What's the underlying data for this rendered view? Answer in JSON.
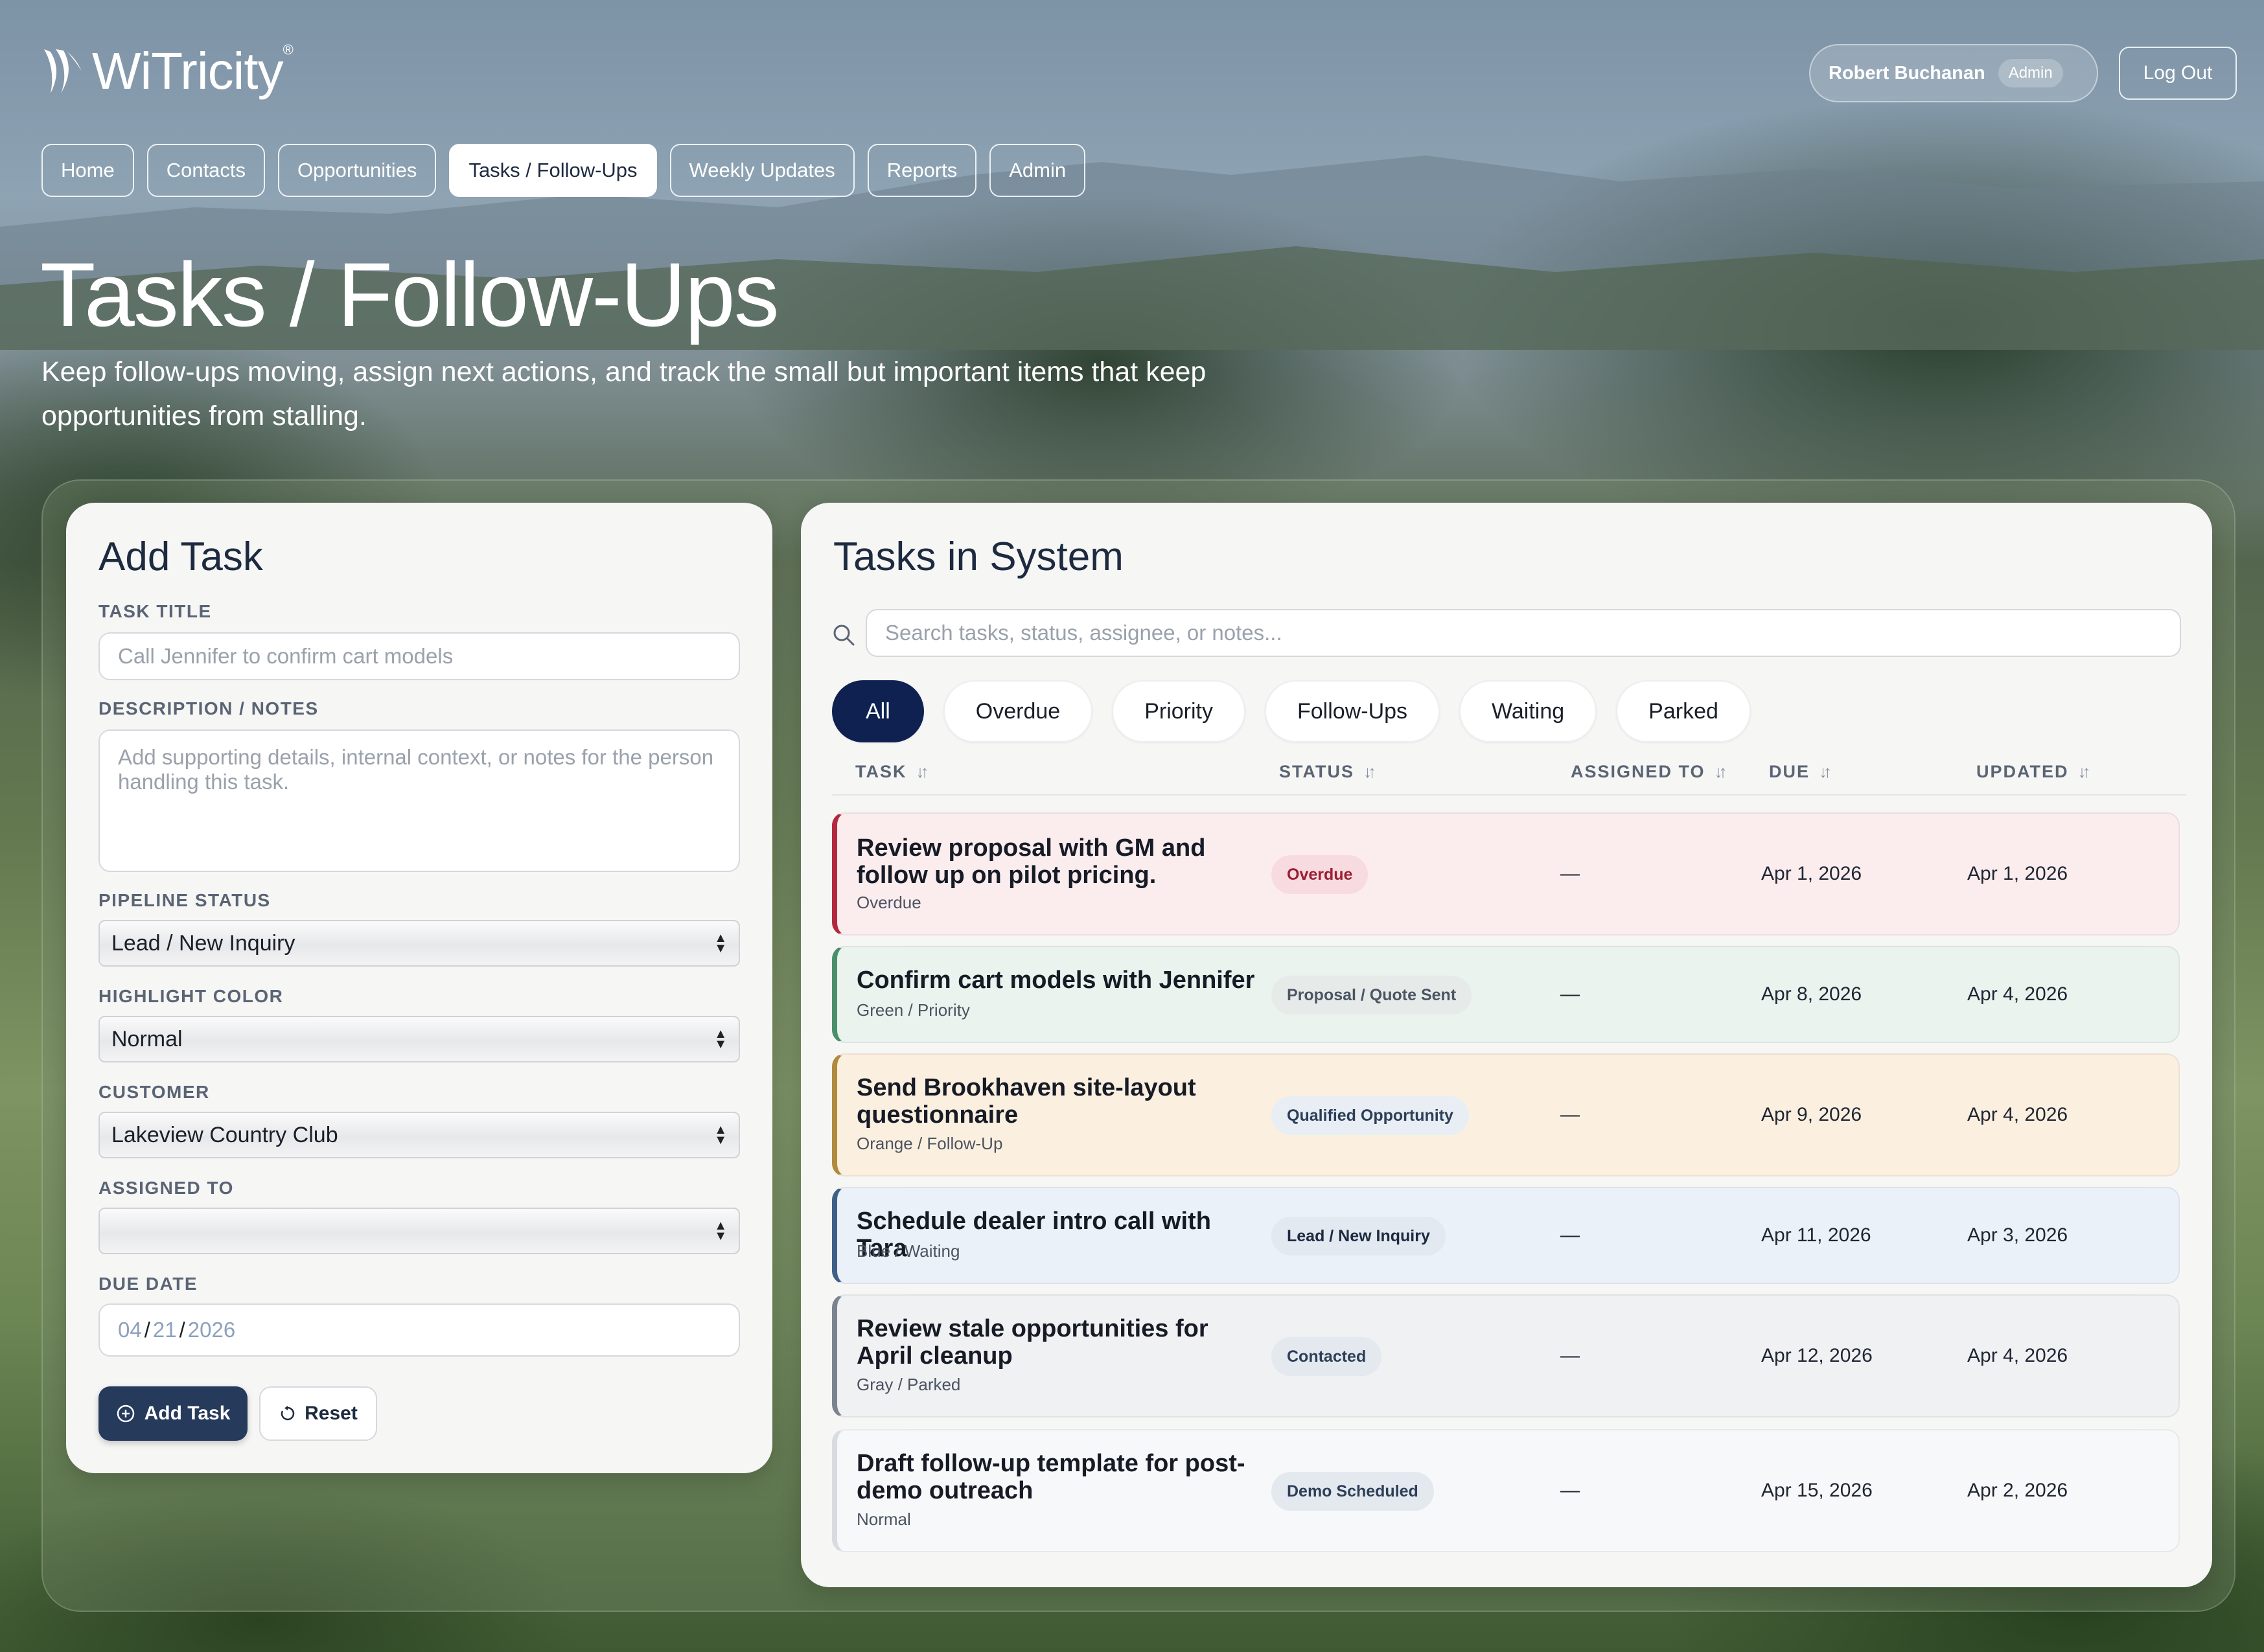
{
  "header": {
    "logo_text": "WiTricity",
    "logo_reg": "®",
    "user_name": "Robert Buchanan",
    "user_role": "Admin",
    "logout_label": "Log Out"
  },
  "nav": {
    "tabs": [
      {
        "label": "Home"
      },
      {
        "label": "Contacts"
      },
      {
        "label": "Opportunities"
      },
      {
        "label": "Tasks / Follow-Ups"
      },
      {
        "label": "Weekly Updates"
      },
      {
        "label": "Reports"
      },
      {
        "label": "Admin"
      }
    ],
    "active_tab": "Tasks / Follow-Ups"
  },
  "page": {
    "title": "Tasks / Follow-Ups",
    "subtitle": "Keep follow-ups moving, assign next actions, and track the small but important items that keep opportunities from stalling."
  },
  "add_task": {
    "title": "Add Task",
    "task_title_label": "TASK TITLE",
    "task_title_placeholder": "Call Jennifer to confirm cart models",
    "description_label": "DESCRIPTION / NOTES",
    "description_placeholder": "Add supporting details, internal context, or notes for the person handling this task.",
    "pipeline_label": "PIPELINE STATUS",
    "pipeline_value": "Lead / New Inquiry",
    "highlight_label": "HIGHLIGHT COLOR",
    "highlight_value": "Normal",
    "customer_label": "CUSTOMER",
    "customer_value": "Lakeview Country Club",
    "assigned_label": "ASSIGNED TO",
    "assigned_value": "",
    "due_label": "DUE DATE",
    "due_month": "04",
    "due_day": "21",
    "due_year": "2026",
    "add_button": "Add Task",
    "reset_button": "Reset"
  },
  "tasks_list": {
    "title": "Tasks in System",
    "search_placeholder": "Search tasks, status, assignee, or notes...",
    "filters": [
      "All",
      "Overdue",
      "Priority",
      "Follow-Ups",
      "Waiting",
      "Parked"
    ],
    "active_filter": "All",
    "columns": [
      "TASK",
      "STATUS",
      "ASSIGNED TO",
      "DUE",
      "UPDATED"
    ],
    "rows": [
      {
        "title": "Review proposal with GM and follow up on pilot pricing.",
        "sub": "Overdue",
        "status": "Overdue",
        "assigned": "—",
        "due": "Apr 1, 2026",
        "updated": "Apr 1, 2026",
        "bg": "#fbecee",
        "border": "#b2293f",
        "badge_bg": "#f8dbe0",
        "badge_fg": "#9a1f32"
      },
      {
        "title": "Confirm cart models with Jennifer",
        "sub": "Green / Priority",
        "status": "Proposal / Quote Sent",
        "assigned": "—",
        "due": "Apr 8, 2026",
        "updated": "Apr 4, 2026",
        "bg": "#eaf3ee",
        "border": "#4a8f6b",
        "badge_bg": "#e6ebea",
        "badge_fg": "#4b5563"
      },
      {
        "title": "Send Brookhaven site-layout questionnaire",
        "sub": "Orange / Follow-Up",
        "status": "Qualified Opportunity",
        "assigned": "—",
        "due": "Apr 9, 2026",
        "updated": "Apr 4, 2026",
        "bg": "#fbf0e0",
        "border": "#b08a3e",
        "badge_bg": "#e8eef4",
        "badge_fg": "#2d3e58"
      },
      {
        "title": "Schedule dealer intro call with Tara",
        "sub": "Blue / Waiting",
        "status": "Lead / New Inquiry",
        "assigned": "—",
        "due": "Apr 11, 2026",
        "updated": "Apr 3, 2026",
        "bg": "#ebf1f8",
        "border": "#3f5f86",
        "badge_bg": "#e2e9f1",
        "badge_fg": "#1d2a3f"
      },
      {
        "title": "Review stale opportunities for April cleanup",
        "sub": "Gray / Parked",
        "status": "Contacted",
        "assigned": "—",
        "due": "Apr 12, 2026",
        "updated": "Apr 4, 2026",
        "bg": "#eff1f3",
        "border": "#7b838e",
        "badge_bg": "#e4e9ef",
        "badge_fg": "#2d3e58"
      },
      {
        "title": "Draft follow-up template for post-demo outreach",
        "sub": "Normal",
        "status": "Demo Scheduled",
        "assigned": "—",
        "due": "Apr 15, 2026",
        "updated": "Apr 2, 2026",
        "bg": "#f7f8f9",
        "border": "#d8dbe0",
        "badge_bg": "#e4e9ef",
        "badge_fg": "#2d3e58"
      }
    ]
  }
}
